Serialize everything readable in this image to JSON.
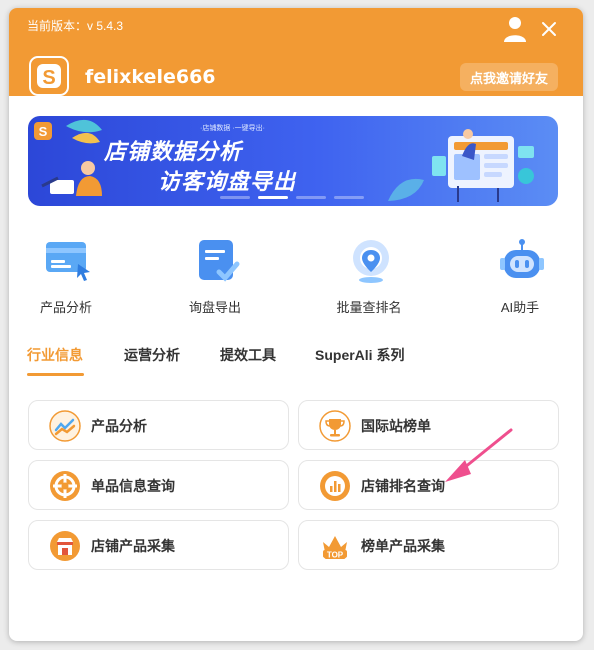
{
  "header": {
    "version_label": "当前版本：v 5.4.3",
    "username": "felixkele666",
    "invite_button": "点我邀请好友"
  },
  "banner": {
    "sub_text": "·店铺数据 ·一键导出·",
    "title_line1": "店铺数据分析",
    "title_line2": "访客询盘导出",
    "active_slide": 2,
    "slide_count": 4
  },
  "tools": [
    {
      "label": "产品分析",
      "icon": "product-analysis-icon"
    },
    {
      "label": "询盘导出",
      "icon": "inquiry-export-icon"
    },
    {
      "label": "批量查排名",
      "icon": "batch-rank-icon"
    },
    {
      "label": "AI助手",
      "icon": "ai-robot-icon"
    }
  ],
  "tabs": [
    {
      "label": "行业信息",
      "active": true
    },
    {
      "label": "运营分析",
      "active": false
    },
    {
      "label": "提效工具",
      "active": false
    },
    {
      "label": "SuperAli 系列",
      "active": false
    }
  ],
  "features": [
    {
      "label": "产品分析",
      "icon": "trend-chart-icon"
    },
    {
      "label": "国际站榜单",
      "icon": "trophy-icon"
    },
    {
      "label": "单品信息查询",
      "icon": "crosshair-icon"
    },
    {
      "label": "店铺排名查询",
      "icon": "bar-chart-icon"
    },
    {
      "label": "店铺产品采集",
      "icon": "store-icon"
    },
    {
      "label": "榜单产品采集",
      "icon": "top-crown-icon"
    }
  ],
  "colors": {
    "brand_orange": "#f29a34",
    "banner_blue": "#3f63f0",
    "arrow_pink": "#ef4f8e"
  }
}
